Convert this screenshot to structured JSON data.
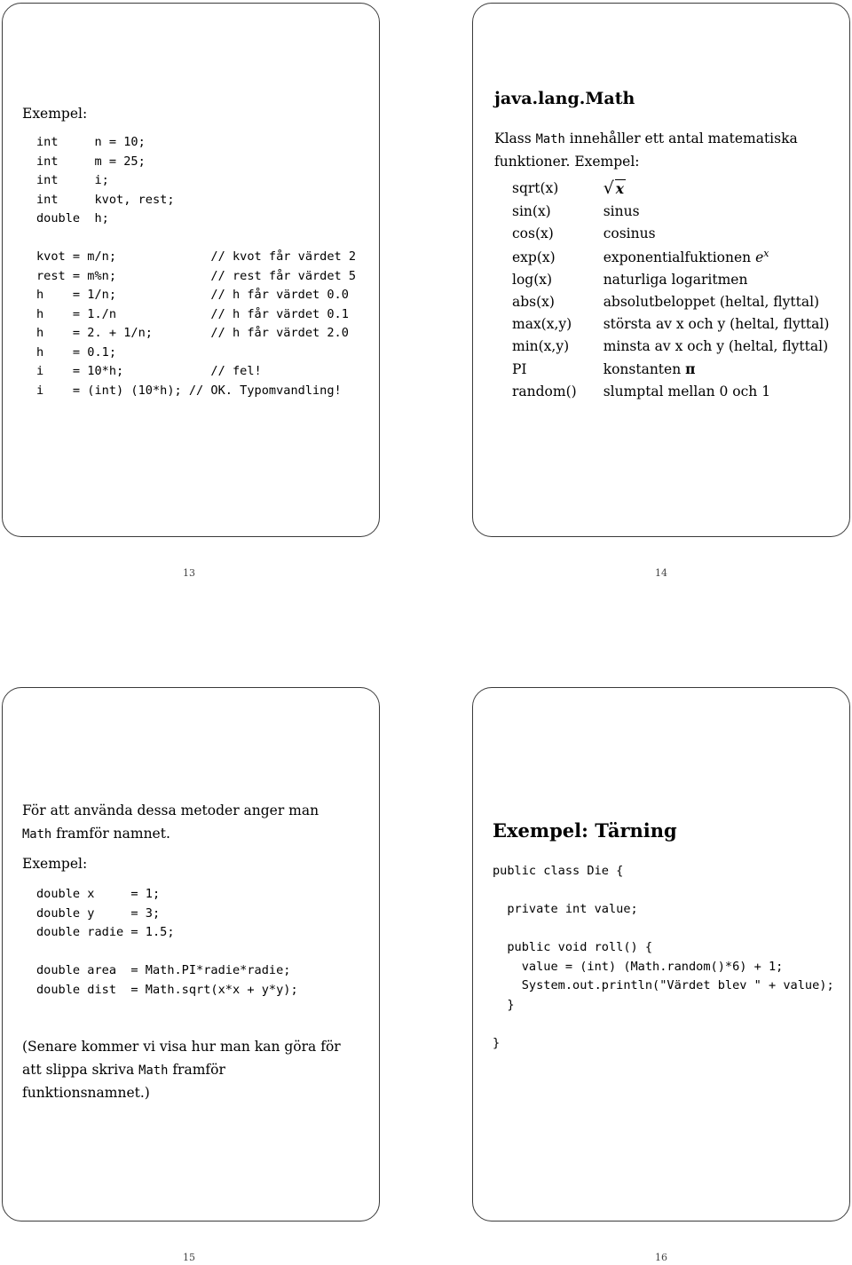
{
  "document": {
    "kind": "lecture-slide-handout",
    "language": "sv",
    "slide_count": 4
  },
  "slides": [
    {
      "id": "slide-13",
      "page_number": "13",
      "label": "Exempel:",
      "code": [
        "int     n = 10;",
        "int     m = 25;",
        "int     i;",
        "int     kvot, rest;",
        "double  h;",
        "",
        "kvot = m/n;             // kvot får värdet 2",
        "rest = m%n;             // rest får värdet 5",
        "h    = 1/n;             // h får värdet 0.0",
        "h    = 1./n             // h får värdet 0.1",
        "h    = 2. + 1/n;        // h får värdet 2.0",
        "h    = 0.1;",
        "i    = 10*h;            // fel!",
        "i    = (int) (10*h); // OK. Typomvandling!"
      ]
    },
    {
      "id": "slide-14",
      "page_number": "14",
      "title": "java.lang.Math",
      "intro_before": "Klass ",
      "intro_mono": "Math",
      "intro_after": " innehåller ett antal matematiska funktioner. Exempel:",
      "table": {
        "rows": [
          {
            "fn": "sqrt(x)",
            "desc": "√x",
            "desc_kind": "sqrt"
          },
          {
            "fn": "sin(x)",
            "desc": "sinus",
            "desc_kind": "text"
          },
          {
            "fn": "cos(x)",
            "desc": "cosinus",
            "desc_kind": "text"
          },
          {
            "fn": "exp(x)",
            "desc": "exponentialfuktionen",
            "desc_kind": "exp",
            "desc_suffix": "e"
          },
          {
            "fn": "log(x)",
            "desc": "naturliga logaritmen",
            "desc_kind": "text"
          },
          {
            "fn": "abs(x)",
            "desc": "absolutbeloppet (heltal, flyttal)",
            "desc_kind": "text"
          },
          {
            "fn": "max(x,y)",
            "desc": "största av x och y (heltal, flyttal)",
            "desc_kind": "text"
          },
          {
            "fn": "min(x,y)",
            "desc": "minsta av x och y (heltal, flyttal)",
            "desc_kind": "text"
          },
          {
            "fn": "PI",
            "desc": "konstanten π",
            "desc_kind": "pi"
          },
          {
            "fn": "random()",
            "desc": "slumptal mellan 0 och 1",
            "desc_kind": "text"
          }
        ]
      }
    },
    {
      "id": "slide-15",
      "page_number": "15",
      "intro_line1": "För att använda dessa metoder anger man",
      "intro_mono": "Math",
      "intro_line2_rest": " framför namnet.",
      "label": "Exempel:",
      "code": [
        "double x     = 1;",
        "double y     = 3;",
        "double radie = 1.5;",
        "",
        "double area  = Math.PI*radie*radie;",
        "double dist  = Math.sqrt(x*x + y*y);"
      ],
      "note_a": "(Senare kommer vi visa hur man kan göra för",
      "note_b_pre": "att slippa skriva ",
      "note_b_mono": "Math",
      "note_b_post": " framför",
      "note_c": "funktionsnamnet.)"
    },
    {
      "id": "slide-16",
      "page_number": "16",
      "title": "Exempel: Tärning",
      "code": [
        "public class Die {",
        "",
        "  private int value;",
        "",
        "  public void roll() {",
        "    value = (int) (Math.random()*6) + 1;",
        "    System.out.println(\"Värdet blev \" + value);",
        "  }",
        "",
        "}"
      ]
    }
  ],
  "colors": {
    "frame_border": "#3a3a3a",
    "text": "#000000",
    "page_number": "#444444",
    "background": "#ffffff"
  }
}
